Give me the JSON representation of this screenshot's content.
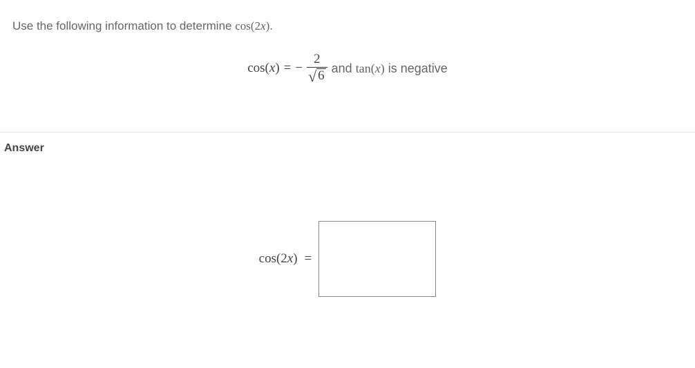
{
  "prompt": {
    "lead": "Use the following information to determine ",
    "target_fn": "cos",
    "target_arg": "(2x)",
    "period": "."
  },
  "given": {
    "lhs_fn": "cos",
    "lhs_arg": "(x)",
    "equals": "=",
    "neg": "−",
    "frac_num": "2",
    "sqrt_arg": "6",
    "trail_and": " and ",
    "trail_fn": "tan",
    "trail_arg": "(x)",
    "trail_rest": " is negative"
  },
  "answer": {
    "label": "Answer",
    "lhs_fn": "cos",
    "lhs_arg": "(2x)",
    "equals": "=",
    "value": ""
  }
}
